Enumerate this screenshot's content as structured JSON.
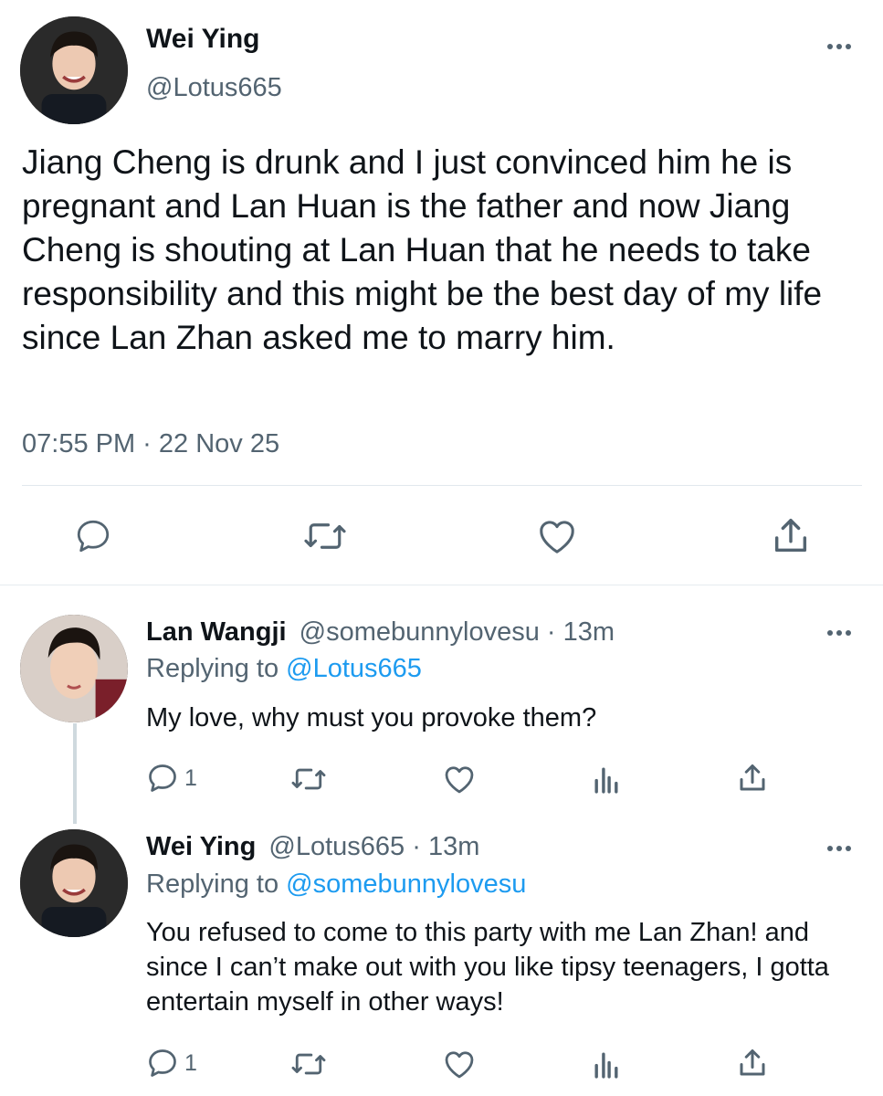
{
  "main_tweet": {
    "author_name": "Wei Ying",
    "handle": "@Lotus665",
    "text": "Jiang Cheng is drunk and I just convinced him he is pregnant and Lan Huan is the father and now Jiang Cheng is shouting at Lan Huan that he needs to take responsibility and this might be the best day of my life since Lan Zhan asked me to marry him.",
    "timestamp": "07:55 PM · 22 Nov 25",
    "actions": [
      "reply-icon",
      "retweet-icon",
      "like-icon",
      "share-icon"
    ]
  },
  "replies": [
    {
      "author_name": "Lan Wangji",
      "handle": "@somebunnylovesu",
      "time": "· 13m",
      "replying_prefix": "Replying to",
      "replying_to": "@Lotus665",
      "text": "My love, why must you provoke them?",
      "reply_count": "1"
    },
    {
      "author_name": "Wei Ying",
      "handle": "@Lotus665",
      "time": "· 13m",
      "replying_prefix": "Replying to",
      "replying_to": "@somebunnylovesu",
      "text": "You refused to come to this party with me Lan Zhan! and since I can’t make out with you like tipsy teenagers, I gotta entertain myself in other ways!",
      "reply_count": "1"
    }
  ],
  "colors": {
    "text": "#0f1419",
    "muted": "#536471",
    "link": "#1d9bf0",
    "divider": "#e1e8ed"
  }
}
